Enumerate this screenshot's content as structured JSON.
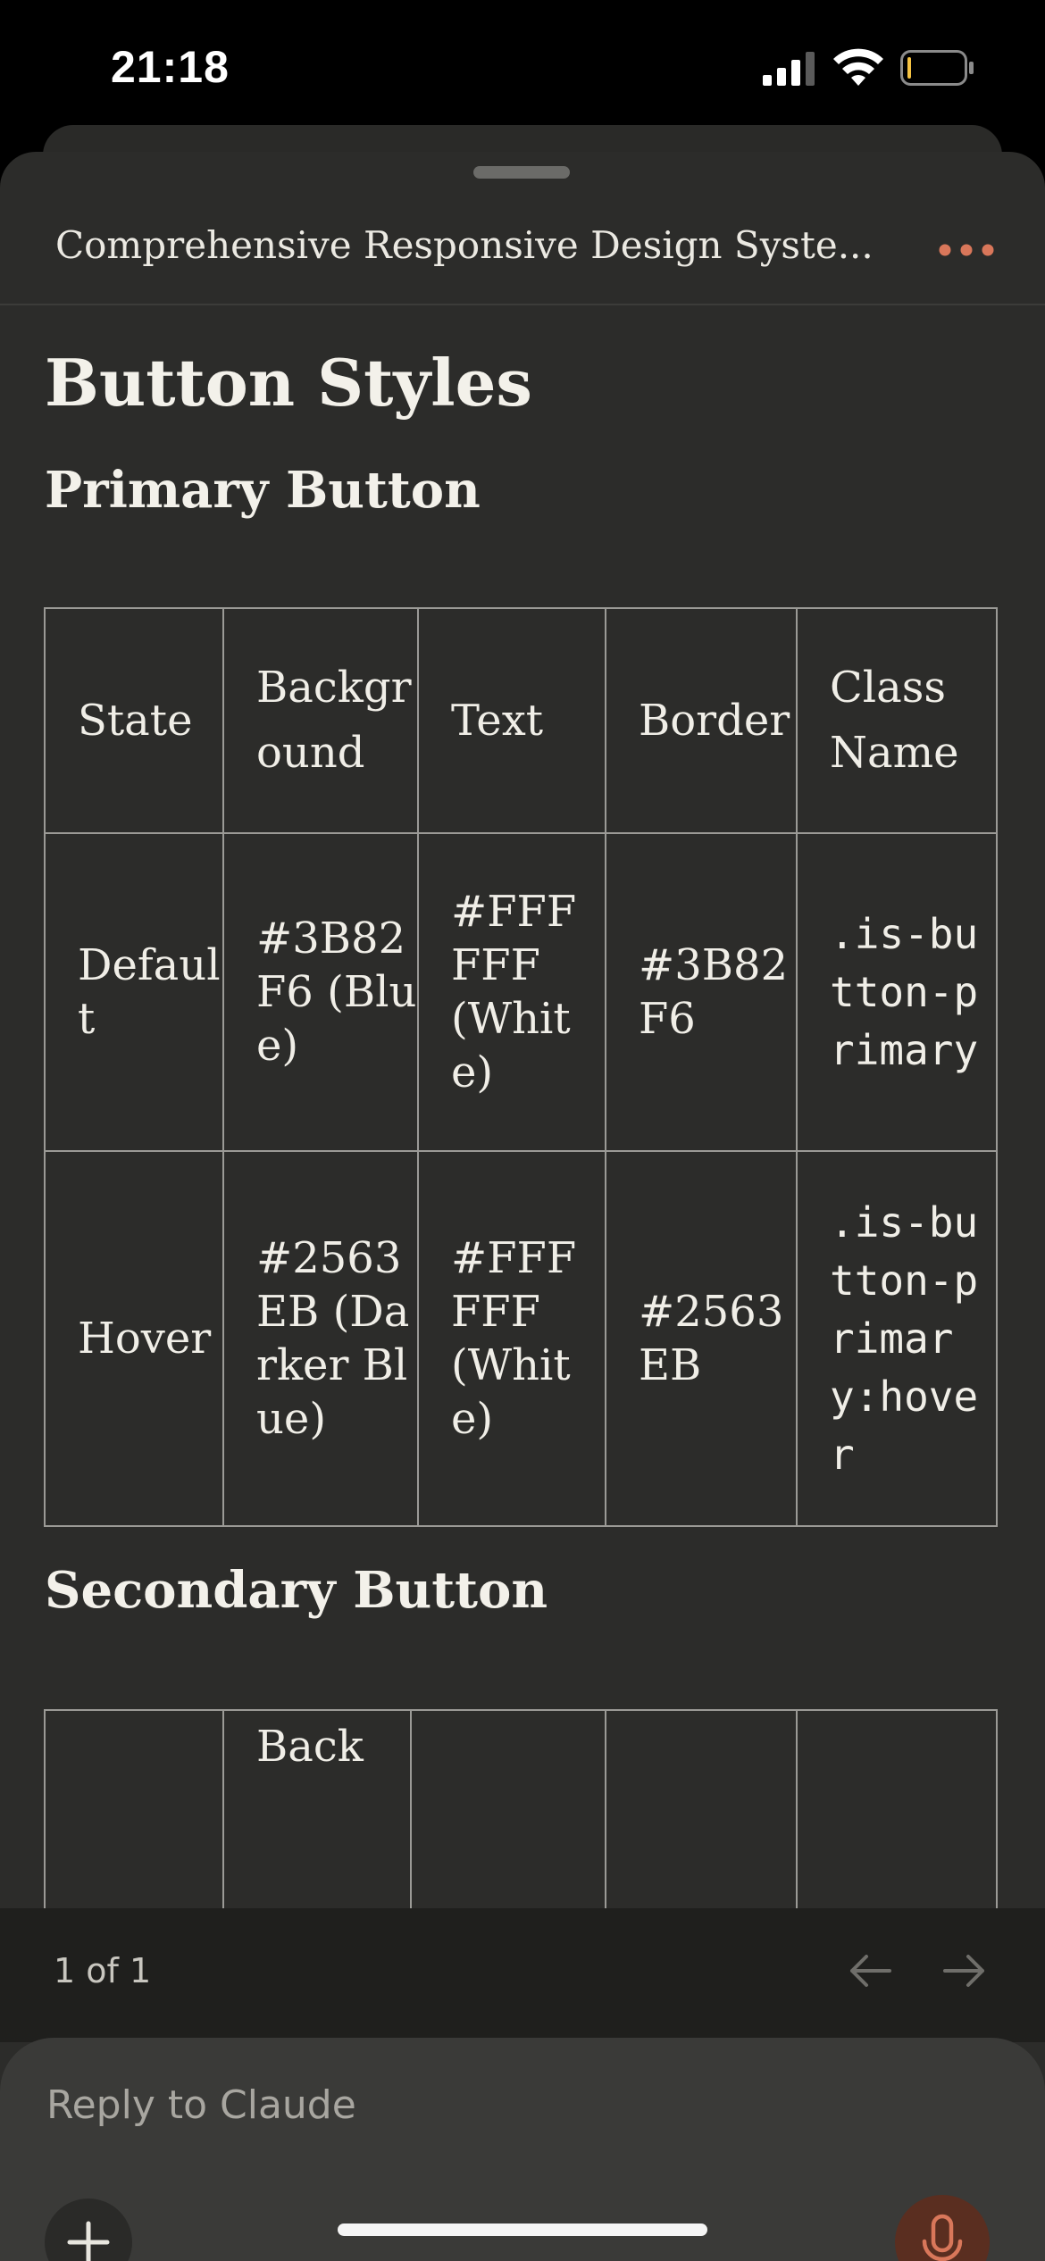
{
  "status_bar": {
    "time": "21:18"
  },
  "document": {
    "title": "Comprehensive Responsive Design Syste..."
  },
  "content": {
    "heading": "Button Styles",
    "primary": {
      "heading": "Primary Button",
      "columns": [
        "State",
        "Background",
        "Text",
        "Border",
        "Class Name"
      ],
      "rows": [
        {
          "state": "Default",
          "background": "#3B82F6 (Blue)",
          "text": "#FFFFFF (White)",
          "border": "#3B82F6",
          "class_name": ".is-button-primary"
        },
        {
          "state": "Hover",
          "background": "#2563EB (Darker Blue)",
          "text": "#FFFFFF (White)",
          "border": "#2563EB",
          "class_name": ".is-button-primary:hover"
        }
      ]
    },
    "secondary": {
      "heading": "Secondary Button",
      "partial_header": "Back"
    }
  },
  "pager": {
    "label": "1 of 1"
  },
  "composer": {
    "placeholder": "Reply to Claude"
  },
  "colors": {
    "accent": "#d9775a",
    "sheet": "#2c2c2a",
    "composer": "#3a3a38"
  },
  "icons": [
    "signal-icon",
    "wifi-icon",
    "battery-icon",
    "more-icon",
    "arrow-left-icon",
    "arrow-right-icon",
    "plus-icon",
    "microphone-icon"
  ]
}
